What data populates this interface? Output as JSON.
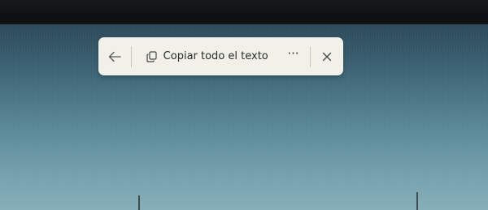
{
  "toolbar": {
    "back_icon": "arrow-left-icon",
    "copy_icon": "copy-icon",
    "copy_all_label": "Copiar todo el texto",
    "more_label": "···",
    "close_icon": "close-icon"
  },
  "colors": {
    "toolbar_bg": "#f1f1ea",
    "screen_top": "#2c4a5a",
    "screen_bottom": "#85aeb8"
  }
}
